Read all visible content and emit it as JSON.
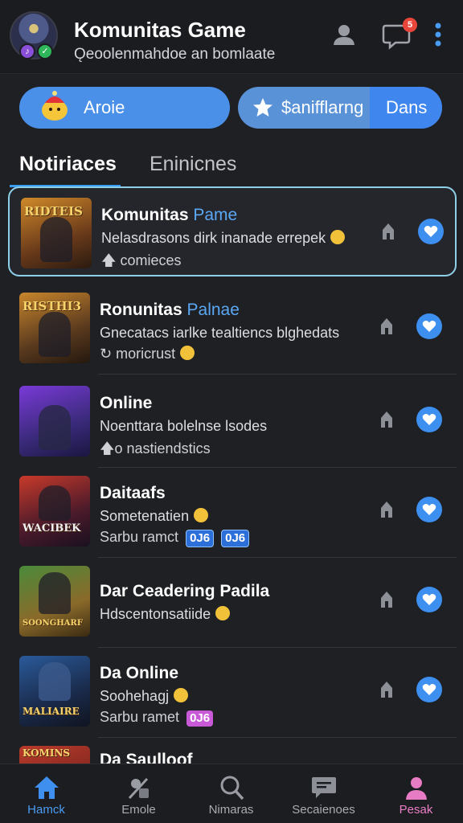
{
  "header": {
    "title": "Komunitas Game",
    "subtitle": "Ǫeoolenmahdoe an bomlaate",
    "notification_badge": "5"
  },
  "pills": {
    "left_label": "Aroie",
    "right_label": "$anifflarng",
    "right_segment_label": "Dans"
  },
  "tabs": [
    {
      "label": "Notiriaces",
      "active": true
    },
    {
      "label": "Eninicnes",
      "active": false
    }
  ],
  "items": [
    {
      "thumb_text": "RIDTEIS",
      "title": "Komunitas",
      "title_accent": "Pame",
      "desc": "Nelasdrasons dirk inanade errepek",
      "meta": "comieces",
      "meta_icon": "arrow-up-icon",
      "highlighted": true
    },
    {
      "thumb_text": "RISTHI3",
      "title": "Ronunitas",
      "title_accent": "Palnae",
      "desc": "Gnecatacs iarlke tealtiencs blghedats",
      "meta": "moricrust",
      "meta_icon": "swirl-icon"
    },
    {
      "thumb_text": "",
      "title": "Online",
      "title_accent": "",
      "desc": "Noenttara bolelnse lsodes",
      "meta": "o nastiendstics",
      "meta_icon": "arrow-up-icon"
    },
    {
      "thumb_text": "WACIBEK",
      "title": "Daitaafs",
      "title_accent": "",
      "desc": "Sometenatien",
      "meta": "Sarbu ramct",
      "tags": [
        "0J6",
        "0J6"
      ],
      "tag_style": "blue"
    },
    {
      "thumb_text": "SOONGHARF",
      "title": "Dar Ceadering Padila",
      "title_accent": "",
      "desc": "Hdscentonsatiide",
      "meta": ""
    },
    {
      "thumb_text": "MALIAIRE",
      "title": "Da Online",
      "title_accent": "",
      "desc": "Soohehagj",
      "meta": "Sarbu ramet",
      "tags": [
        "0J6"
      ],
      "tag_style": "pink"
    },
    {
      "thumb_text": "KOMINS",
      "title": "Da Saulloof",
      "title_accent": "",
      "desc": "",
      "meta": ""
    }
  ],
  "bottom_nav": [
    {
      "label": "Hamck",
      "icon": "home-icon",
      "active": true
    },
    {
      "label": "Emole",
      "icon": "game-icon"
    },
    {
      "label": "Nimaras",
      "icon": "search-icon"
    },
    {
      "label": "Secaienoes",
      "icon": "chat-icon"
    },
    {
      "label": "Pesak",
      "icon": "profile-icon"
    }
  ],
  "colors": {
    "accent": "#3d8ff0",
    "background": "#1f2024",
    "highlight_border": "#8ed0ea"
  }
}
